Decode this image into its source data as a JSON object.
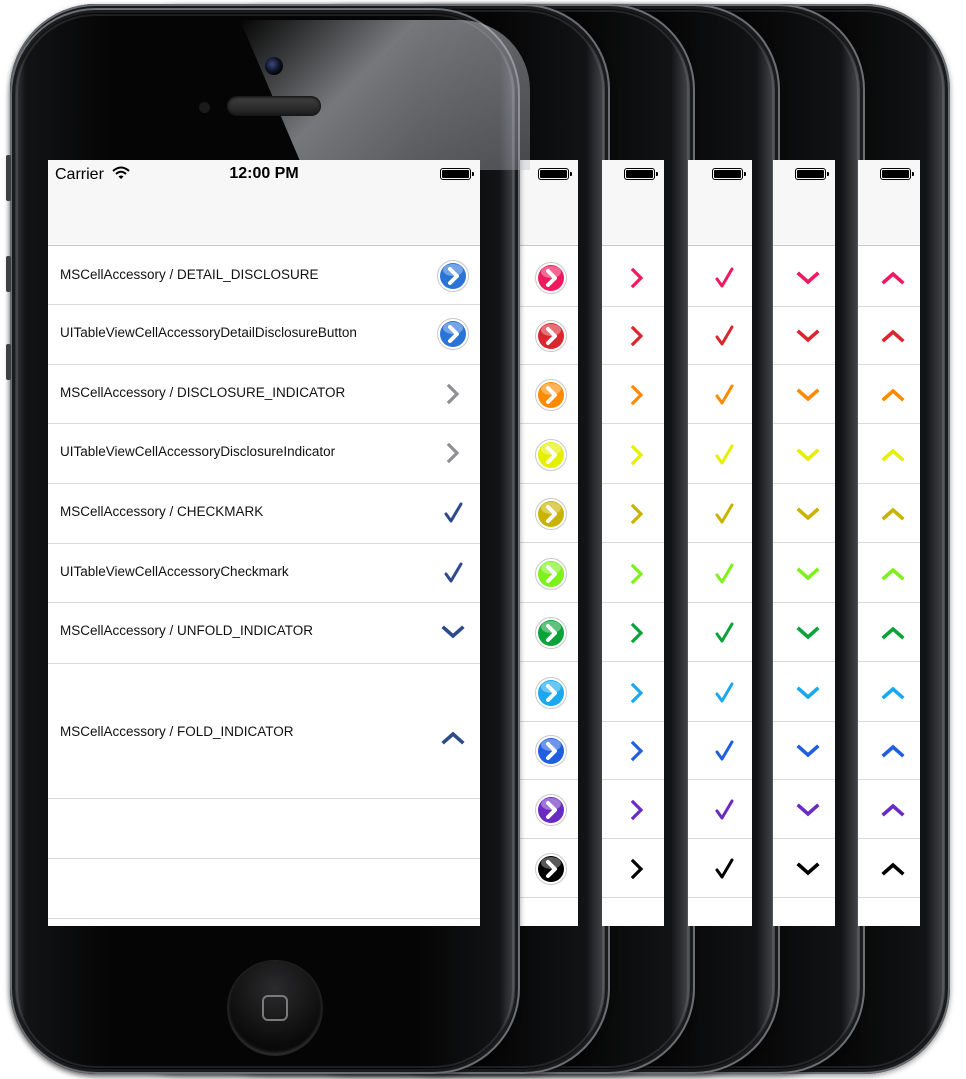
{
  "status_bar": {
    "carrier": "Carrier",
    "time": "12:00 PM"
  },
  "rows": [
    {
      "label": "MSCellAccessory / DETAIL_DISCLOSURE",
      "accessory": "detail-disclosure-icon"
    },
    {
      "label": "UITableViewCellAccessoryDetailDisclosureButton",
      "accessory": "detail-disclosure-icon"
    },
    {
      "label": "MSCellAccessory / DISCLOSURE_INDICATOR",
      "accessory": "chevron-right-icon"
    },
    {
      "label": "UITableViewCellAccessoryDisclosureIndicator",
      "accessory": "chevron-right-icon"
    },
    {
      "label": "MSCellAccessory / CHECKMARK",
      "accessory": "checkmark-icon"
    },
    {
      "label": "UITableViewCellAccessoryCheckmark",
      "accessory": "checkmark-icon"
    },
    {
      "label": "MSCellAccessory / UNFOLD_INDICATOR",
      "accessory": "chevron-down-icon"
    },
    {
      "label": "MSCellAccessory / FOLD_INDICATOR",
      "accessory": "chevron-up-icon"
    },
    {
      "label": "",
      "accessory": ""
    },
    {
      "label": "",
      "accessory": ""
    }
  ],
  "colors": {
    "front_accent": "#2f4a8a",
    "front_disclosure_blue": "#2a74d8",
    "front_gray_chevron": "#8e8e93",
    "palette": [
      "#f0185f",
      "#d9262f",
      "#ff8a00",
      "#e4f000",
      "#c8b400",
      "#7ef01a",
      "#0aa33a",
      "#1aa9f0",
      "#1f5fe0",
      "#6a2bc4",
      "#000000"
    ]
  },
  "back_screens": [
    {
      "accessory": "detail-disclosure-icon"
    },
    {
      "accessory": "chevron-right-icon"
    },
    {
      "accessory": "checkmark-icon"
    },
    {
      "accessory": "chevron-down-icon"
    },
    {
      "accessory": "chevron-up-icon"
    }
  ]
}
